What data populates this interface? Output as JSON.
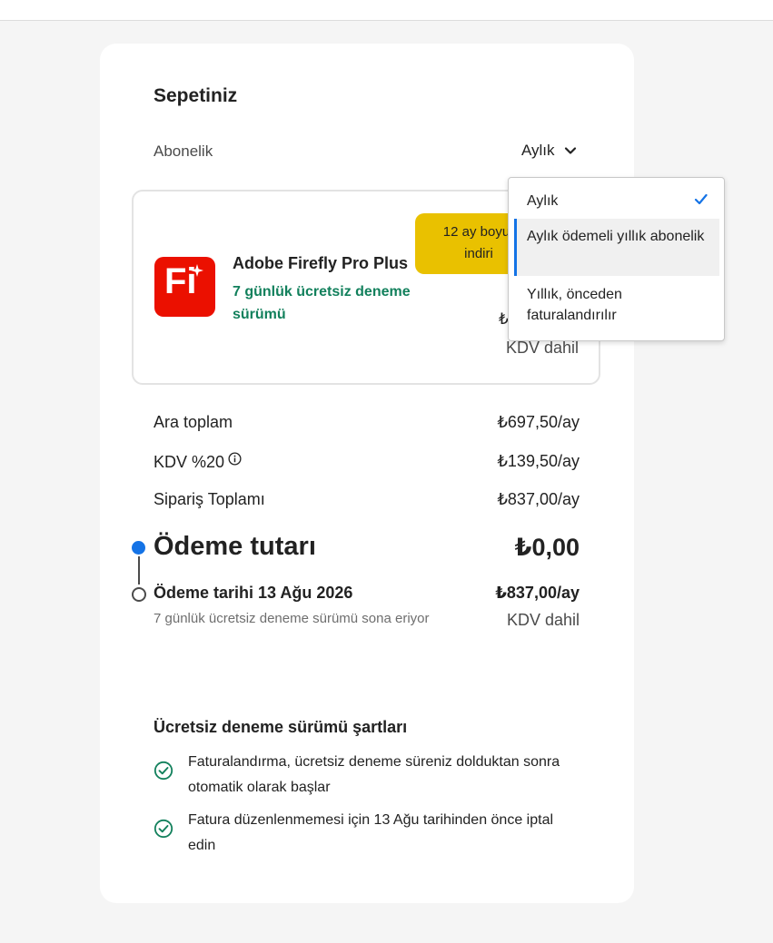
{
  "cart": {
    "title": "Sepetiniz",
    "subscription_label": "Abonelik",
    "subscription_selected": "Aylık"
  },
  "dropdown": {
    "options": [
      "Aylık",
      "Aylık ödemeli yıllık abonelik",
      "Yıllık, önceden faturalandırılır"
    ]
  },
  "product": {
    "badge": "12 ay boyunca indirim",
    "badge_line1": "12 ay boyur",
    "badge_line2": "indiri",
    "logo_text": "Fi",
    "name": "Adobe Firefly Pro Plus",
    "trial": "7 günlük ücretsiz deneme sürümü",
    "price_partial": "₺",
    "vat": "KDV dahil",
    "logo_color": "#eb1000"
  },
  "summary": {
    "subtotal_label": "Ara toplam",
    "subtotal_value": "₺697,50/ay",
    "vat_label": "KDV %20",
    "vat_value": "₺139,50/ay",
    "order_total_label": "Sipariş Toplamı",
    "order_total_value": "₺837,00/ay"
  },
  "payment": {
    "title": "Ödeme tutarı",
    "value": "₺0,00",
    "date_title": "Ödeme tarihi 13 Ağu 2026",
    "date_value": "₺837,00/ay",
    "note": "7 günlük ücretsiz deneme sürümü sona eriyor",
    "vat": "KDV dahil"
  },
  "terms": {
    "title": "Ücretsiz deneme sürümü şartları",
    "items": [
      "Faturalandırma, ücretsiz deneme süreniz dolduktan sonra otomatik olarak başlar",
      "Fatura düzenlenmemesi için 13 Ağu tarihinden önce iptal edin"
    ]
  },
  "colors": {
    "accent": "#1473e6",
    "trial_green": "#12805c",
    "badge_yellow": "#e9c100",
    "check_green": "#12805c"
  }
}
